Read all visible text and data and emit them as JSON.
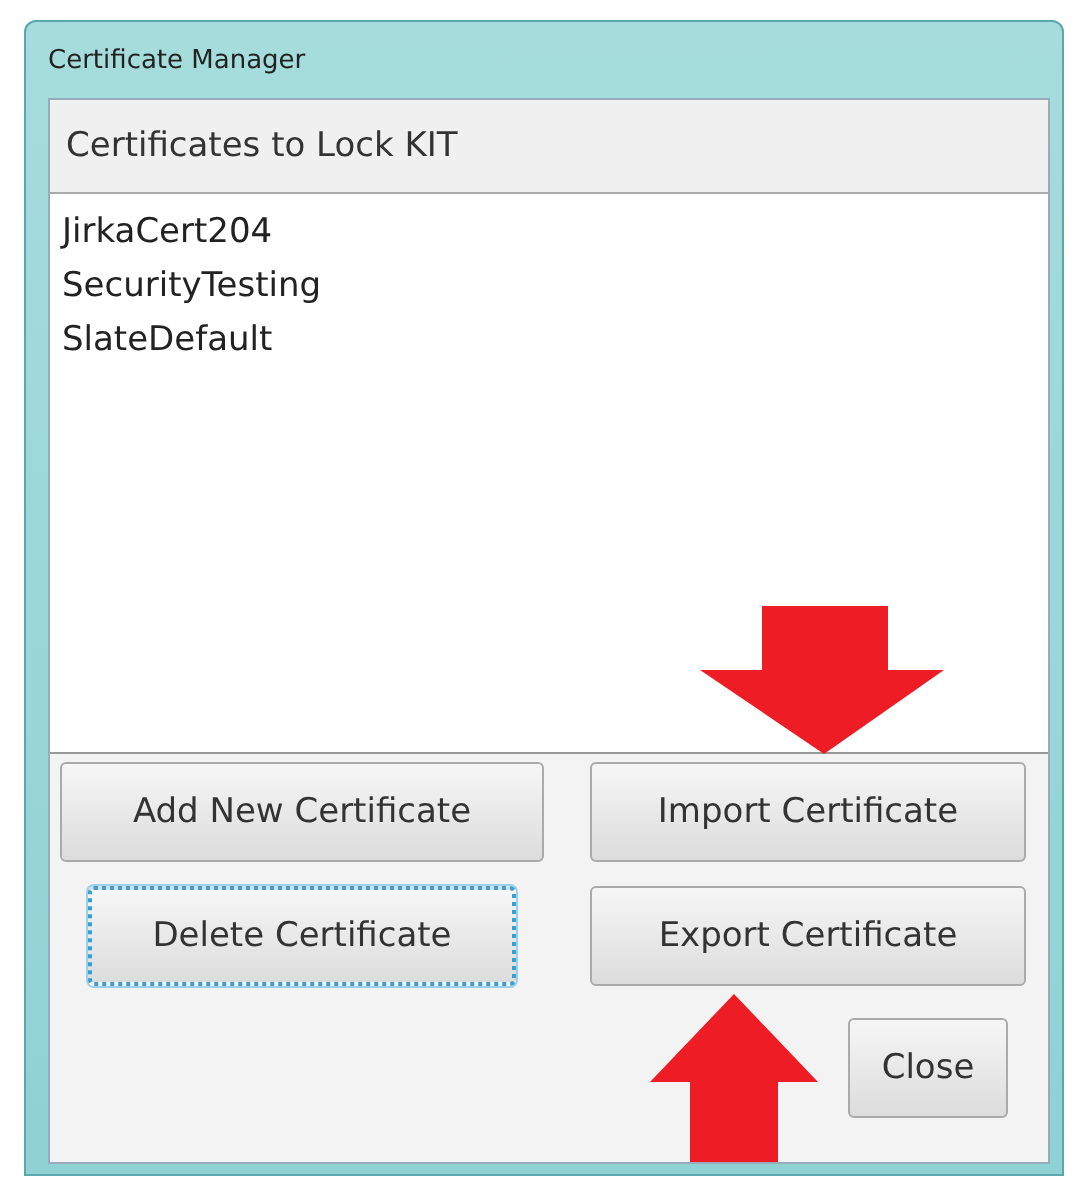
{
  "window": {
    "title": "Certificate Manager"
  },
  "list": {
    "header": "Certificates to Lock KIT",
    "items": [
      {
        "label": "JirkaCert204",
        "selected": false
      },
      {
        "label": "SecurityTesting",
        "selected": false
      },
      {
        "label": "SlateDefault",
        "selected": false
      }
    ]
  },
  "buttons": [
    {
      "label": "Add New Certificate",
      "focused": false
    },
    {
      "label": "Import Certificate",
      "focused": false
    },
    {
      "label": "Delete Certificate",
      "focused": true
    },
    {
      "label": "Export Certificate",
      "focused": false
    },
    {
      "label": "Close",
      "focused": false
    }
  ]
}
